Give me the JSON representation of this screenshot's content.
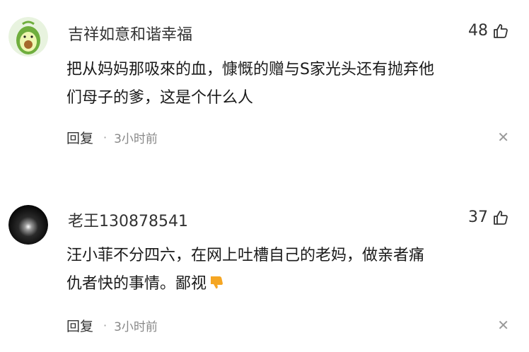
{
  "comments": [
    {
      "username": "吉祥如意和谐幸福",
      "avatar_icon": "avocado-avatar-icon",
      "likes": "48",
      "lines": [
        "把从妈妈那吸來的血，慷慨的赠与S家光头还有抛弃他",
        "们母子的爹，这是个什么人"
      ],
      "reply_label": "回复",
      "separator": "·",
      "time": "3小时前",
      "close_icon": "close-icon"
    },
    {
      "username": "老王130878541",
      "avatar_icon": "dark-sphere-avatar-icon",
      "likes": "37",
      "lines": [
        "汪小菲不分四六，在网上吐槽自己的老妈，做亲者痛",
        "仇者快的事情。鄙视"
      ],
      "emoji": "thumbs-down-emoji",
      "reply_label": "回复",
      "separator": "·",
      "time": "3小时前",
      "close_icon": "close-icon"
    }
  ],
  "colors": {
    "text": "#1a1a1a",
    "meta": "#888888",
    "emoji": "#f5a623"
  }
}
